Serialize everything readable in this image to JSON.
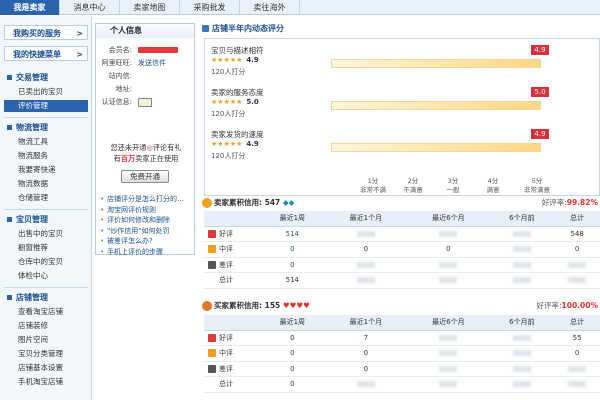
{
  "topnav": {
    "tabs": [
      {
        "label": "我是卖家",
        "active": true
      },
      {
        "label": "消息中心"
      },
      {
        "label": "卖家地图"
      },
      {
        "label": "采购批发"
      },
      {
        "label": "卖往海外"
      }
    ]
  },
  "sidebar": {
    "buy_service": "我购买的服务",
    "quick_menu": "我的快捷菜单",
    "groups": [
      {
        "title": "交易管理",
        "items": [
          "已卖出的宝贝",
          "评价管理"
        ]
      },
      {
        "title": "物流管理",
        "items": [
          "物流工具",
          "物流服务",
          "我要寄快递",
          "物流数据",
          "仓储管理"
        ]
      },
      {
        "title": "宝贝管理",
        "items": [
          "出售中的宝贝",
          "橱窗推荐",
          "仓库中的宝贝",
          "体检中心"
        ]
      },
      {
        "title": "店铺管理",
        "items": [
          "查看淘宝店铺",
          "店铺装修",
          "图片空间",
          "宝贝分类管理",
          "店铺基本设置",
          "手机淘宝店铺"
        ]
      }
    ],
    "active_item": "评价管理"
  },
  "info": {
    "title": "个人信息",
    "member_label": "会员名:",
    "aliww_label": "阿里旺旺:",
    "aliww_value": "发送信件",
    "mail_label": "站内信:",
    "addr_label": "地址:",
    "auth_label": "认证信息:",
    "promo_line1": "您还未开通",
    "promo_line1b": "评论有礼",
    "promo_line2a": "有",
    "promo_line2b": "百万",
    "promo_line2c": "卖家正在使用",
    "free_button": "免费开通",
    "links": [
      "店铺评分是怎么打分的...",
      "淘宝网评价规则",
      "评价如何修改和删除",
      "\"炒作信用\"如何处罚",
      "被差评怎么办?",
      "手机上评价的步骤"
    ]
  },
  "dsr": {
    "title": "店铺半年内动态评分",
    "metrics": [
      {
        "label": "宝贝与描述相符",
        "score": "4.9",
        "flag": "4.9",
        "count": "120人打分"
      },
      {
        "label": "卖家的服务态度",
        "score": "5.0",
        "flag": "5.0",
        "count": "120人打分"
      },
      {
        "label": "卖家发货的速度",
        "score": "4.9",
        "flag": "4.9",
        "count": "120人打分"
      }
    ],
    "scale": [
      {
        "score": "1分",
        "desc": "非常不满"
      },
      {
        "score": "2分",
        "desc": "不满意"
      },
      {
        "score": "3分",
        "desc": "一般"
      },
      {
        "score": "4分",
        "desc": "满意"
      },
      {
        "score": "5分",
        "desc": "非常满意"
      }
    ],
    "stars": "★★★★★"
  },
  "seller_credit": {
    "label": "卖家累积信用:",
    "score": "547",
    "gems": "◆◆",
    "good_rate_label": "好评率:",
    "good_rate": "99.82%",
    "columns": [
      "",
      "最近1周",
      "最近1个月",
      "最近6个月",
      "6个月前",
      "总计"
    ],
    "rows": [
      {
        "name": "好评",
        "icon_color": "#e23a3a",
        "values": [
          "514",
          "",
          "",
          "",
          "548"
        ]
      },
      {
        "name": "中评",
        "icon_color": "#f0a020",
        "values": [
          "0",
          "0",
          "0",
          "",
          "0"
        ]
      },
      {
        "name": "差评",
        "icon_color": "#555555",
        "values": [
          "0",
          "",
          "",
          "",
          ""
        ]
      },
      {
        "name": "总计",
        "icon_color": "",
        "values": [
          "514",
          "",
          "",
          "",
          ""
        ]
      }
    ]
  },
  "buyer_credit": {
    "label": "买家累积信用:",
    "score": "155",
    "hearts": "♥♥♥♥",
    "good_rate_label": "好评率:",
    "good_rate": "100.00%",
    "columns": [
      "",
      "最近1周",
      "最近1个月",
      "最近6个月",
      "6个月前",
      "总计"
    ],
    "rows": [
      {
        "name": "好评",
        "icon_color": "#e23a3a",
        "values": [
          "0",
          "7",
          "",
          "",
          "55"
        ]
      },
      {
        "name": "中评",
        "icon_color": "#f0a020",
        "values": [
          "0",
          "0",
          "",
          "",
          "0"
        ]
      },
      {
        "name": "差评",
        "icon_color": "#555555",
        "values": [
          "0",
          "0",
          "",
          "",
          ""
        ]
      },
      {
        "name": "总计",
        "icon_color": "",
        "values": [
          "0",
          "",
          "",
          "",
          ""
        ]
      }
    ]
  }
}
